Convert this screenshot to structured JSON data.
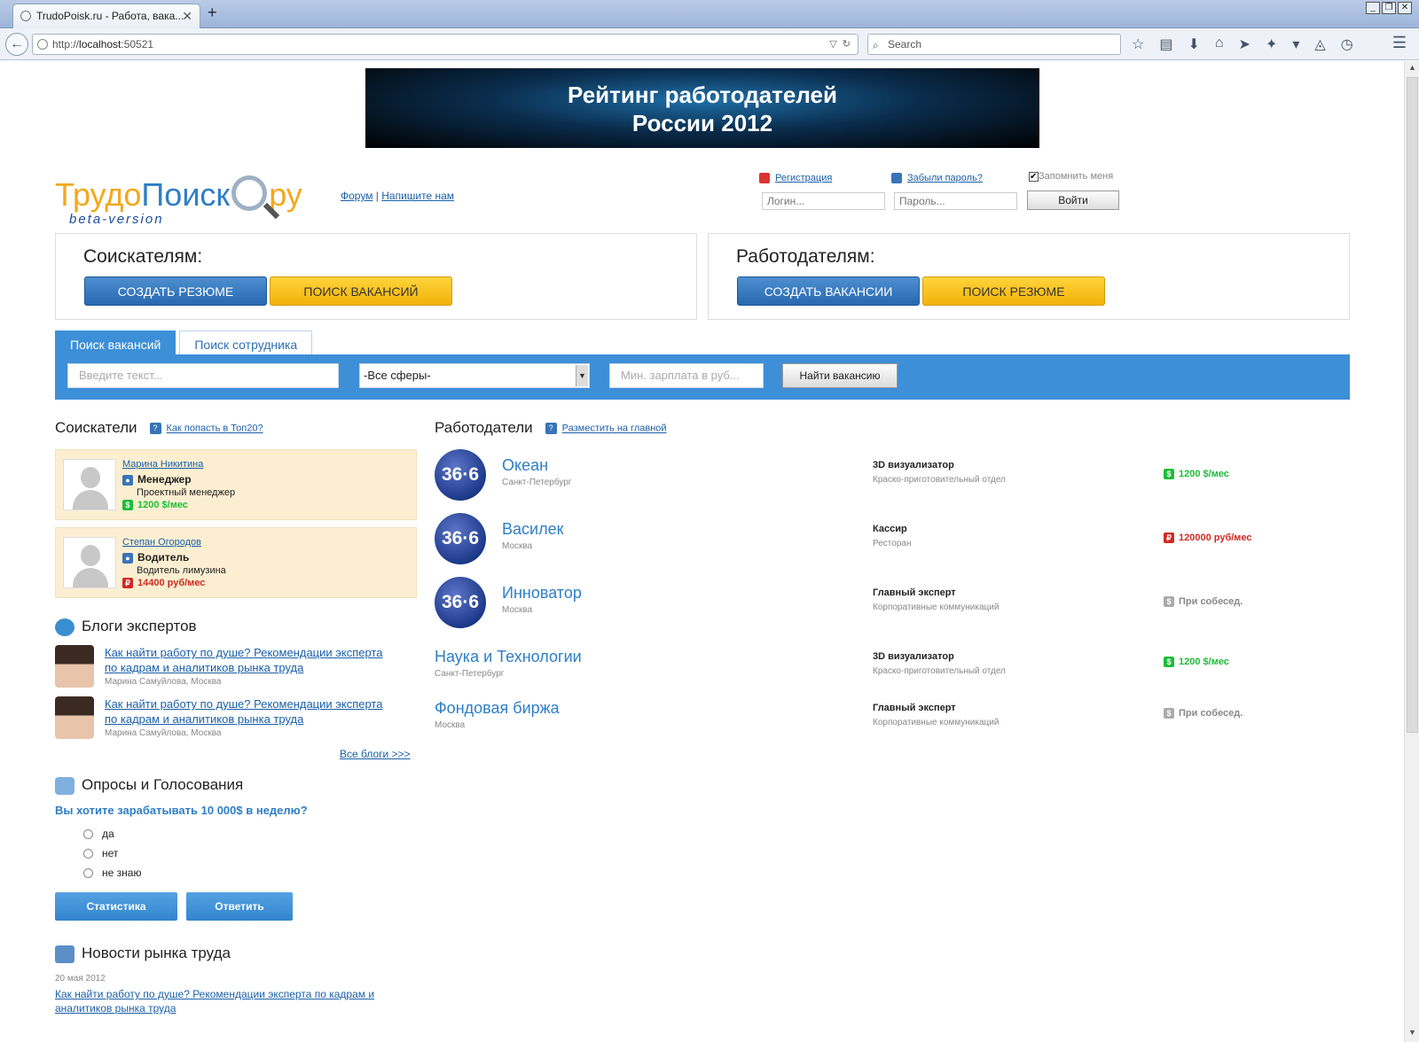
{
  "browser": {
    "tab_title": "TrudoPoisk.ru - Работа, вака...",
    "url_prefix": "http://",
    "url_host": "localhost",
    "url_port": ":50521",
    "search_placeholder": "Search"
  },
  "banner": {
    "line1": "Рейтинг работодателей",
    "line2": "России 2012"
  },
  "logo": {
    "part_a": "Трудо",
    "part_b": "Поиск",
    "part_c": "ру",
    "beta": "beta-version"
  },
  "toplinks": {
    "forum": "Форум",
    "sep": " | ",
    "write": "Напишите нам"
  },
  "auth": {
    "register": "Регистрация",
    "forgot": "Забыли пароль?",
    "remember": "Запомнить меня",
    "login_placeholder": "Логин...",
    "password_placeholder": "Пароль...",
    "login_button": "Войти"
  },
  "seekers_panel": {
    "title": "Соискателям:",
    "btn_create": "СОЗДАТЬ РЕЗЮМЕ",
    "btn_search": "ПОИСК ВАКАНСИЙ"
  },
  "employers_panel": {
    "title": "Работодателям:",
    "btn_create": "СОЗДАТЬ ВАКАНСИИ",
    "btn_search": "ПОИСК РЕЗЮМЕ"
  },
  "search": {
    "tabs": [
      "Поиск вакансий",
      "Поиск сотрудника"
    ],
    "text_placeholder": "Введите текст...",
    "sphere": "-Все сферы-",
    "salary_placeholder": "Мин. зарплата в руб...",
    "button": "Найти вакансию"
  },
  "seekers": {
    "title": "Соискатели",
    "link": "Как попасть в Топ20?",
    "items": [
      {
        "name": "Марина Никитина",
        "position": "Менеджер",
        "sub": "Проектный менеджер",
        "salary": "1200 $/мес",
        "cur": "$"
      },
      {
        "name": "Степан Огородов",
        "position": "Водитель",
        "sub": "Водитель лимузина",
        "salary": "14400 руб/мес",
        "cur": "₽"
      }
    ]
  },
  "blogs": {
    "title": "Блоги экспертов",
    "items": [
      {
        "text": "Как найти работу по душе? Рекомендации эксперта по кадрам и аналитиков рынка труда",
        "meta": "Марина Самуйлова, Москва"
      },
      {
        "text": "Как найти работу по душе? Рекомендации эксперта по кадрам и аналитиков рынка труда",
        "meta": "Марина Самуйлова, Москва"
      }
    ],
    "all": "Все блоги >>>"
  },
  "poll": {
    "title": "Опросы и Голосования",
    "question": "Вы хотите зарабатывать 10 000$ в неделю?",
    "options": [
      "да",
      "нет",
      "не знаю"
    ],
    "btn_stats": "Статистика",
    "btn_answer": "Ответить"
  },
  "news": {
    "title": "Новости рынка труда",
    "date": "20 мая 2012",
    "text": "Как найти работу по душе? Рекомендации эксперта по кадрам и аналитиков рынка труда"
  },
  "employers": {
    "title": "Работодатели",
    "link": "Разместить на главной",
    "logo_text": "36·6",
    "items": [
      {
        "name": "Океан",
        "city": "Санкт-Петербург",
        "vacancy": "3D визуализатор",
        "dept": "Краско-приготовительный отдел",
        "salary": "1200 $/мес",
        "cur": "$"
      },
      {
        "name": "Василек",
        "city": "Москва",
        "vacancy": "Кассир",
        "dept": "Ресторан",
        "salary": "120000 руб/мес",
        "cur": "₽"
      },
      {
        "name": "Инноватор",
        "city": "Москва",
        "vacancy": "Главный эксперт",
        "dept": "Корпоративные коммуникаций",
        "salary": "При собесед.",
        "cur": "$"
      },
      {
        "name": "Наука и Технологии",
        "city": "Санкт-Петербург",
        "vacancy": "3D визуализатор",
        "dept": "Краско-приготовительный отдел",
        "salary": "1200 $/мес",
        "cur": "$"
      },
      {
        "name": "Фондовая биржа",
        "city": "Москва",
        "vacancy": "Главный эксперт",
        "dept": "Корпоративные коммуникаций",
        "salary": "При собесед.",
        "cur": "$"
      }
    ]
  }
}
